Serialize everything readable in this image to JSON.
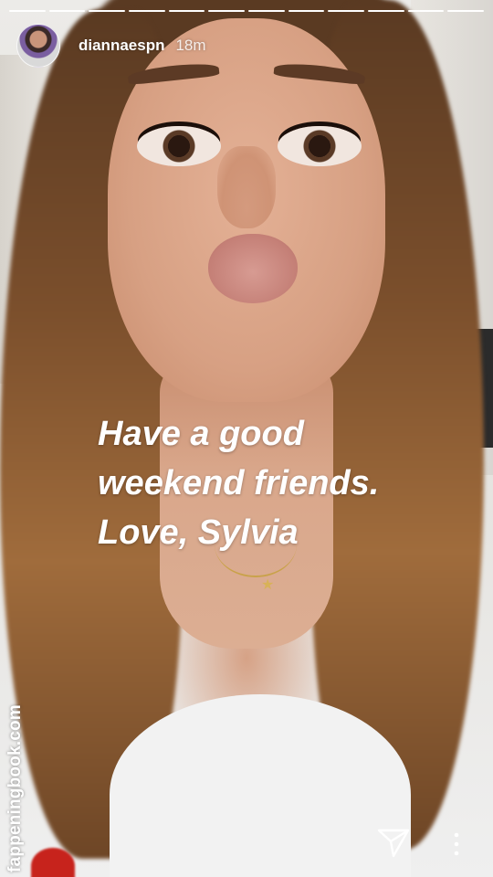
{
  "story": {
    "progress_segments": 12,
    "username": "diannaespn",
    "time_ago": "18m",
    "caption_lines": [
      "Have a good",
      "weekend friends.",
      "Love, Sylvia"
    ],
    "watermark": "fappeningbook.com"
  },
  "icons": {
    "avatar": "avatar",
    "send": "send-icon",
    "more": "more-vertical-icon"
  },
  "colors": {
    "overlay_text": "#ffffff",
    "progress": "#ffffff"
  }
}
